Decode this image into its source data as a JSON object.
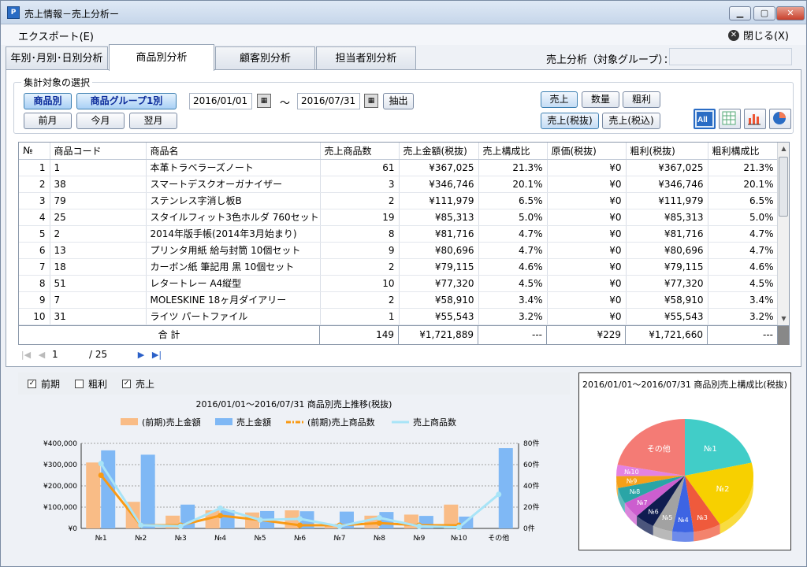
{
  "window": {
    "title": "売上情報－売上分析ー",
    "icon": "app-icon"
  },
  "menu": {
    "export": "エクスポート(E)",
    "close": "閉じる(X)"
  },
  "tabs": [
    {
      "label": "年別･月別･日別分析"
    },
    {
      "label": "商品別分析"
    },
    {
      "label": "顧客別分析"
    },
    {
      "label": "担当者別分析"
    }
  ],
  "group_label": "売上分析（対象グループ）：",
  "selection": {
    "legend": "集計対象の選択",
    "by_product": "商品別",
    "by_group": "商品グループ1別",
    "date_from": "2016/01/01",
    "tilde": "～",
    "date_to": "2016/07/31",
    "extract": "抽出",
    "prev_month": "前月",
    "this_month": "今月",
    "next_month": "翌月",
    "sales": "売上",
    "quantity": "数量",
    "gross": "粗利",
    "sales_ex": "売上(税抜)",
    "sales_in": "売上(税込)"
  },
  "table": {
    "headers": [
      "№",
      "商品コード",
      "商品名",
      "売上商品数",
      "売上金額(税抜)",
      "売上構成比",
      "原価(税抜)",
      "粗利(税抜)",
      "粗利構成比"
    ],
    "rows": [
      [
        "1",
        "1",
        "本革トラベラーズノート",
        "61",
        "¥367,025",
        "21.3%",
        "¥0",
        "¥367,025",
        "21.3%"
      ],
      [
        "2",
        "38",
        "スマートデスクオーガナイザー",
        "3",
        "¥346,746",
        "20.1%",
        "¥0",
        "¥346,746",
        "20.1%"
      ],
      [
        "3",
        "79",
        "ステンレス字消し板B",
        "2",
        "¥111,979",
        "6.5%",
        "¥0",
        "¥111,979",
        "6.5%"
      ],
      [
        "4",
        "25",
        "スタイルフィット3色ホルダ 760セット",
        "19",
        "¥85,313",
        "5.0%",
        "¥0",
        "¥85,313",
        "5.0%"
      ],
      [
        "5",
        "2",
        " 2014年版手帳(2014年3月始まり)",
        "8",
        "¥81,716",
        "4.7%",
        "¥0",
        "¥81,716",
        "4.7%"
      ],
      [
        "6",
        "13",
        "プリンタ用紙 給与封筒 10個セット",
        "9",
        "¥80,696",
        "4.7%",
        "¥0",
        "¥80,696",
        "4.7%"
      ],
      [
        "7",
        "18",
        "カーボン紙 筆記用 黒 10個セット",
        "2",
        "¥79,115",
        "4.6%",
        "¥0",
        "¥79,115",
        "4.6%"
      ],
      [
        "8",
        "51",
        "レタートレー A4縦型",
        "10",
        "¥77,320",
        "4.5%",
        "¥0",
        "¥77,320",
        "4.5%"
      ],
      [
        "9",
        "7",
        "MOLESKINE 18ヶ月ダイアリー",
        "2",
        "¥58,910",
        "3.4%",
        "¥0",
        "¥58,910",
        "3.4%"
      ],
      [
        "10",
        "31",
        "ライツ パートファイル",
        "1",
        "¥55,543",
        "3.2%",
        "¥0",
        "¥55,543",
        "3.2%"
      ]
    ],
    "total": {
      "label": "合 計",
      "qty": "149",
      "amount": "¥1,721,889",
      "ratio": "---",
      "cost": "¥229",
      "gross": "¥1,721,660",
      "gross_ratio": "---"
    }
  },
  "pager": {
    "page": "1",
    "of": "/ 25"
  },
  "options": {
    "prev_period": "前期",
    "gross": "粗利",
    "sales": "売上"
  },
  "chart_data": [
    {
      "type": "bar",
      "title": "2016/01/01～2016/07/31  商品別売上推移(税抜)",
      "categories": [
        "№1",
        "№2",
        "№3",
        "№4",
        "№5",
        "№6",
        "№7",
        "№8",
        "№9",
        "№10",
        "その他"
      ],
      "series": [
        {
          "name": "(前期)売上金額",
          "kind": "bar",
          "axis": "left",
          "color": "#f9bc86",
          "values": [
            310000,
            125000,
            60000,
            85000,
            75000,
            85000,
            10000,
            60000,
            65000,
            112000,
            0
          ]
        },
        {
          "name": "売上金額",
          "kind": "bar",
          "axis": "left",
          "color": "#7fb8f5",
          "values": [
            367025,
            346746,
            111979,
            85313,
            81716,
            80696,
            79115,
            77320,
            58910,
            55543,
            377536
          ]
        },
        {
          "name": "(前期)売上商品数",
          "kind": "line",
          "axis": "right",
          "color": "#f99a14",
          "values": [
            50,
            3,
            3,
            12,
            8,
            3,
            3,
            5,
            3,
            3,
            null
          ]
        },
        {
          "name": "売上商品数",
          "kind": "line",
          "axis": "right",
          "color": "#a8e4f7",
          "values": [
            61,
            3,
            2,
            19,
            8,
            9,
            2,
            10,
            2,
            1,
            32
          ]
        }
      ],
      "ylim": [
        0,
        400000
      ],
      "y2lim": [
        0,
        80
      ],
      "y_ticks": [
        "¥400,000",
        "¥300,000",
        "¥200,000",
        "¥100,000",
        "¥0"
      ],
      "y2_ticks": [
        "80件",
        "60件",
        "40件",
        "20件",
        "0件"
      ],
      "legend": "top"
    },
    {
      "type": "pie",
      "title": "2016/01/01～2016/07/31  商品別売上構成比(税抜)",
      "categories": [
        "№1",
        "№2",
        "№3",
        "№4",
        "№5",
        "№6",
        "№7",
        "№8",
        "№9",
        "№10",
        "その他"
      ],
      "values": [
        21.3,
        20.1,
        6.5,
        5.0,
        4.7,
        4.7,
        4.6,
        4.5,
        3.4,
        3.2,
        21.9
      ],
      "colors": [
        "#41cdc8",
        "#f7d000",
        "#ef5a3c",
        "#3d64e3",
        "#a2a2a2",
        "#0f1c50",
        "#cc5ecf",
        "#2aa5a6",
        "#f4a018",
        "#e482e2",
        "#f47b75"
      ]
    }
  ]
}
